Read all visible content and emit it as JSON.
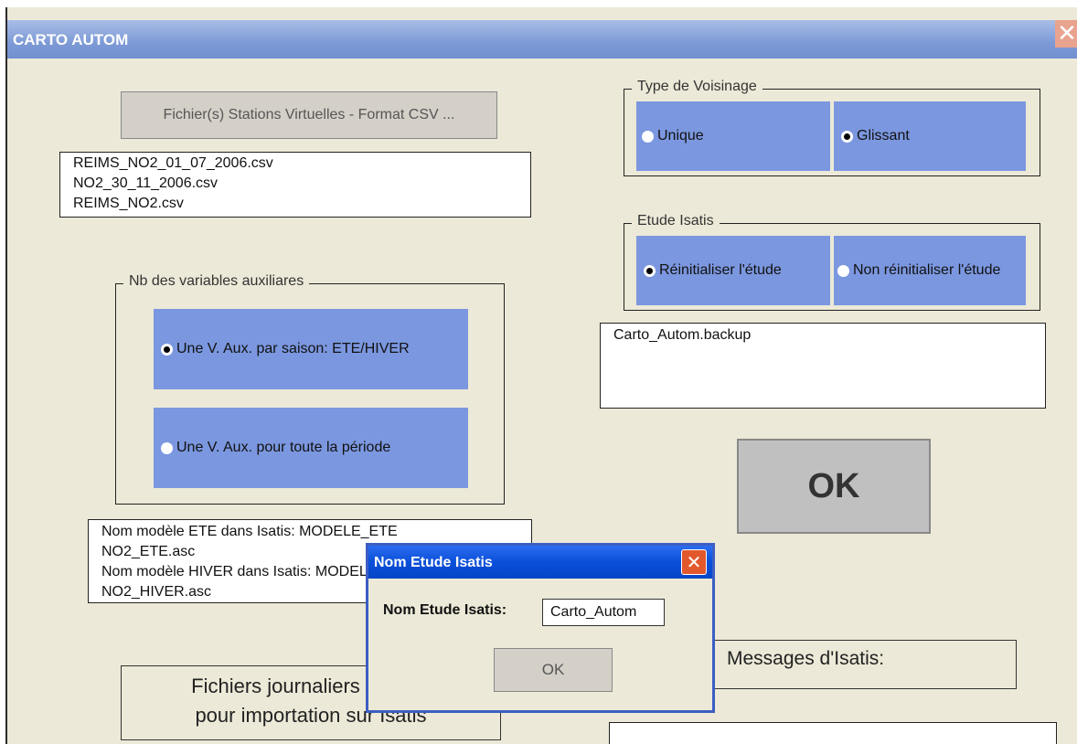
{
  "window": {
    "title": "CARTO AUTOM",
    "close_glyph": "✕"
  },
  "files_button": {
    "label": "Fichier(s) Stations Virtuelles - Format CSV ..."
  },
  "files_list": {
    "items": [
      "REIMS_NO2_01_07_2006.csv",
      "NO2_30_11_2006.csv",
      "REIMS_NO2.csv"
    ]
  },
  "aux_vars": {
    "legend": "Nb des variables auxiliares",
    "option1": "Une V. Aux. par saison: ETE/HIVER",
    "option2": "Une V. Aux. pour toute la période",
    "selected": "option1"
  },
  "models_list": {
    "items": [
      "Nom modèle ETE dans Isatis: MODELE_ETE",
      "NO2_ETE.asc",
      "Nom modèle HIVER dans Isatis: MODELE_HIVER",
      "NO2_HIVER.asc"
    ]
  },
  "daily_files_button": {
    "line1": "Fichiers journaliers avec ...",
    "line2": "pour importation sur Isatis"
  },
  "voisinage": {
    "legend": "Type de Voisinage",
    "option1": "Unique",
    "option2": "Glissant",
    "selected": "option2"
  },
  "etude": {
    "legend": "Etude Isatis",
    "option1": "Réinitialiser l'étude",
    "option2": "Non réinitialiser l'étude",
    "selected": "option1"
  },
  "backup_list": {
    "items": [
      "Carto_Autom.backup"
    ]
  },
  "ok_button": {
    "label": "OK"
  },
  "messages": {
    "label": "Messages d'Isatis:"
  },
  "dialog": {
    "title": "Nom Etude Isatis",
    "close_glyph": "✕",
    "field_label": "Nom Etude Isatis:",
    "field_value": "Carto_Autom",
    "ok_label": "OK"
  },
  "colors": {
    "option_bg": "#7b97df",
    "window_bg": "#ece9d8",
    "dialog_title": "#0a4fd9"
  }
}
